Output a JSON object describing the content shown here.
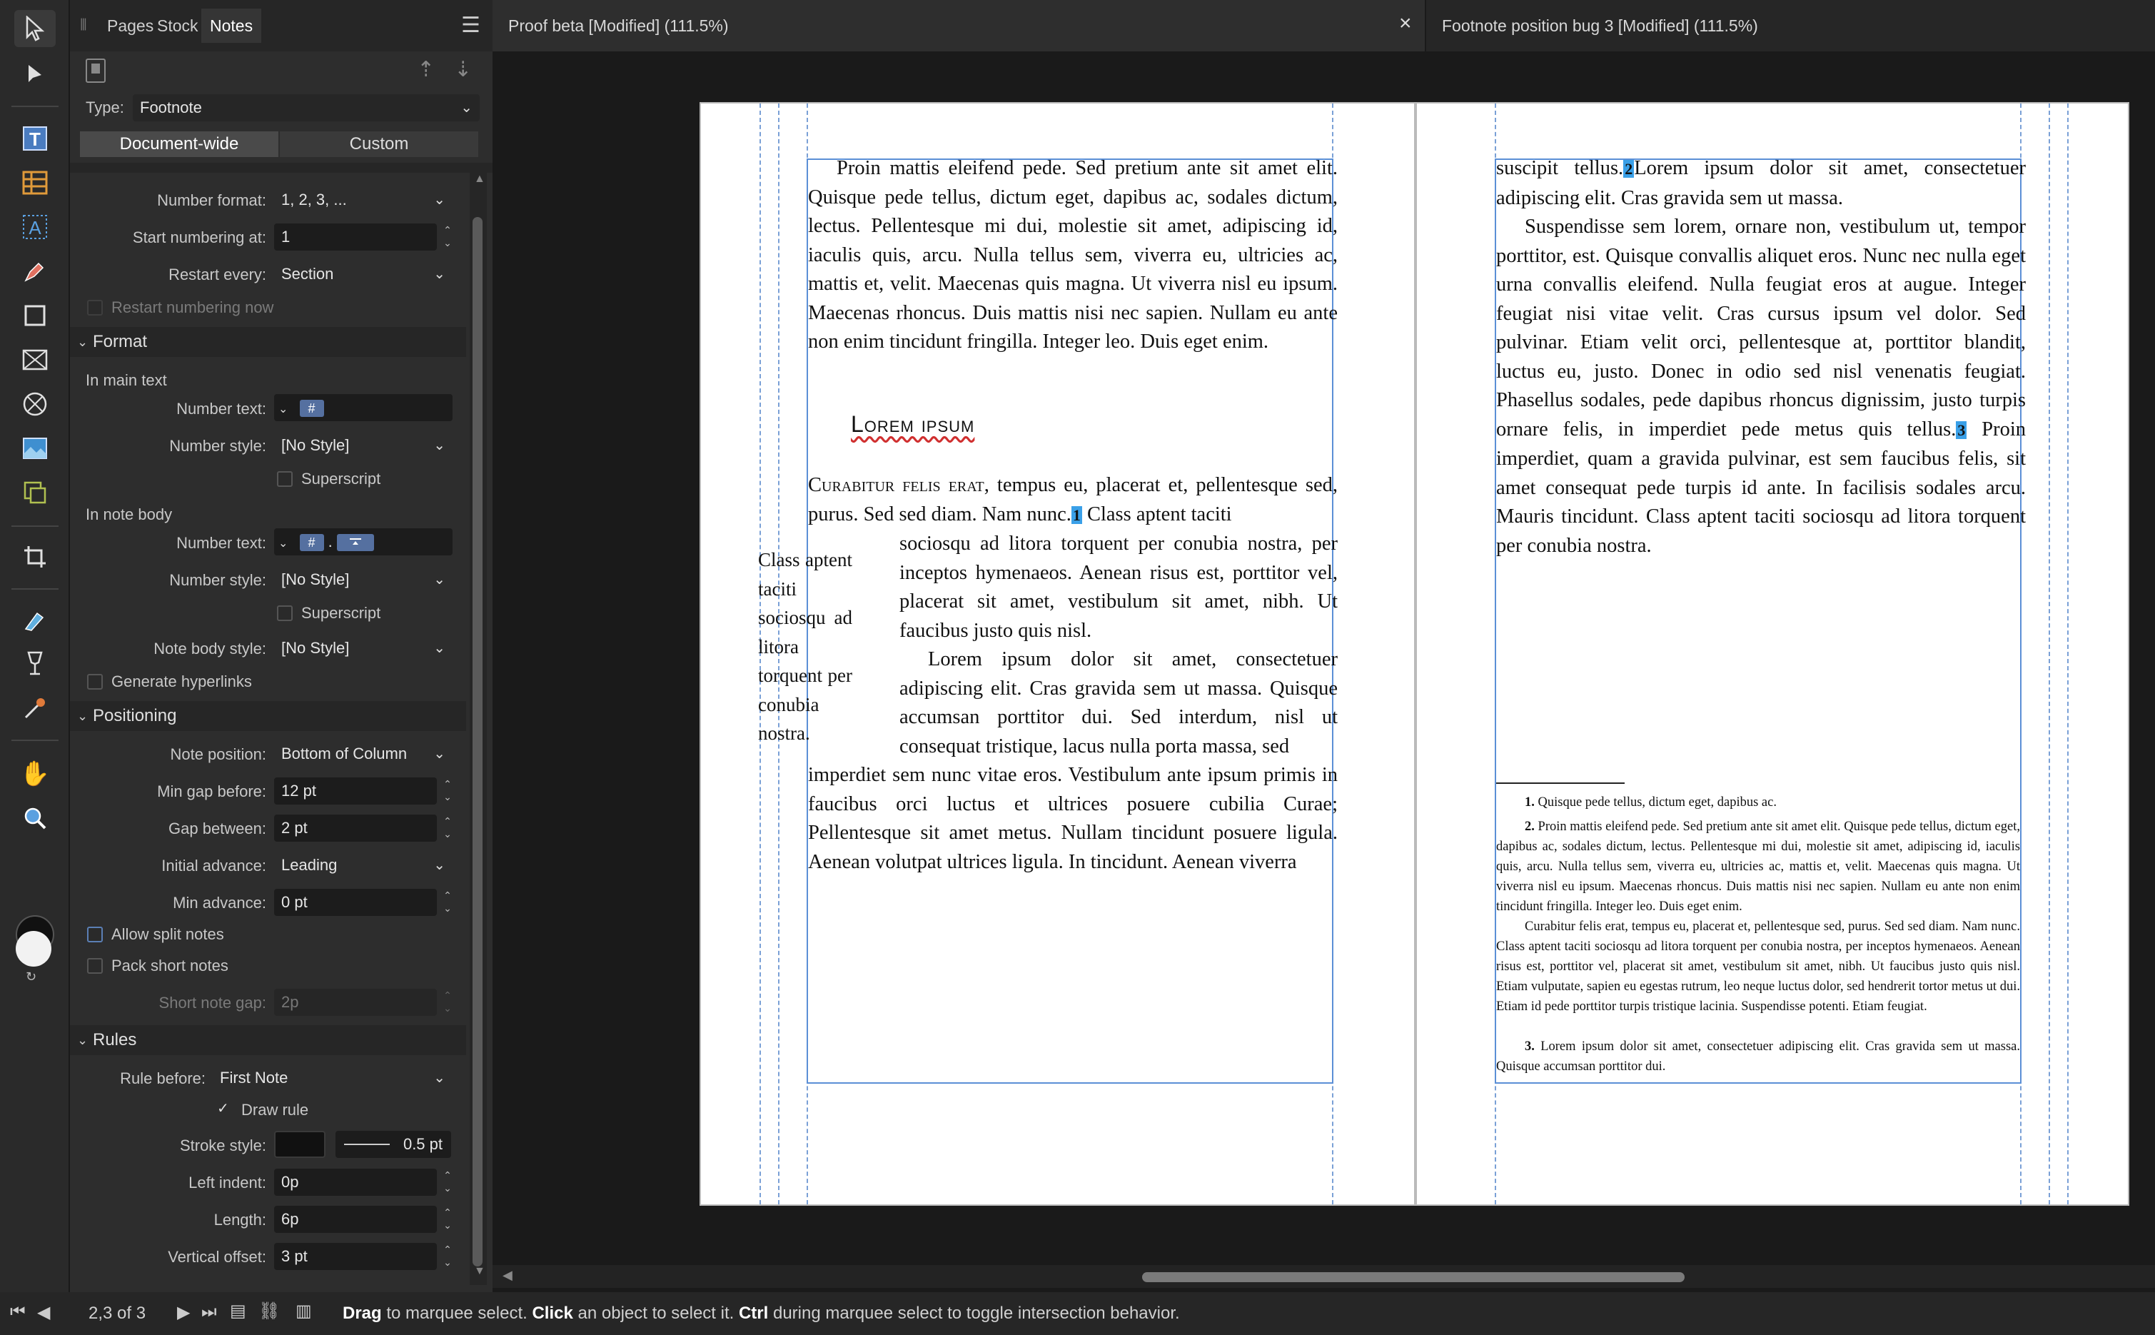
{
  "panel": {
    "tabs": [
      "Pages",
      "Stock",
      "Notes"
    ],
    "type_label": "Type:",
    "type_value": "Footnote",
    "scope_tabs": [
      "Document-wide",
      "Custom"
    ],
    "number_format_label": "Number format:",
    "number_format_value": "1, 2, 3, ...",
    "start_numbering_label": "Start numbering at:",
    "start_numbering_value": "1",
    "restart_every_label": "Restart every:",
    "restart_every_value": "Section",
    "restart_now_label": "Restart numbering now",
    "format_section": "Format",
    "in_main_text": "In main text",
    "number_text_label": "Number text:",
    "number_token": "#",
    "number_style_label": "Number style:",
    "number_style_value": "[No Style]",
    "superscript_label": "Superscript",
    "in_note_body": "In note body",
    "note_number_sep": ".",
    "note_body_style_label": "Note body style:",
    "note_body_style_value": "[No Style]",
    "generate_hyperlinks_label": "Generate hyperlinks",
    "positioning_section": "Positioning",
    "note_position_label": "Note position:",
    "note_position_value": "Bottom of Column",
    "min_gap_label": "Min gap before:",
    "min_gap_value": "12 pt",
    "gap_between_label": "Gap between:",
    "gap_between_value": "2 pt",
    "initial_advance_label": "Initial advance:",
    "initial_advance_value": "Leading",
    "min_advance_label": "Min advance:",
    "min_advance_value": "0 pt",
    "allow_split_label": "Allow split notes",
    "pack_short_label": "Pack short notes",
    "short_gap_label": "Short note gap:",
    "short_gap_value": "2p",
    "rules_section": "Rules",
    "rule_before_label": "Rule before:",
    "rule_before_value": "First Note",
    "draw_rule_label": "Draw rule",
    "stroke_style_label": "Stroke style:",
    "stroke_width_value": "0.5 pt",
    "left_indent_label": "Left indent:",
    "left_indent_value": "0p",
    "length_label": "Length:",
    "length_value": "6p",
    "vertical_offset_label": "Vertical offset:",
    "vertical_offset_value": "3 pt"
  },
  "documents": {
    "tab1": "Proof beta [Modified] (111.5%)",
    "tab2": "Footnote position bug 3 [Modified] (111.5%)",
    "close_glyph": "×"
  },
  "left_page": {
    "para1": "Proin mattis eleifend pede. Sed pretium ante sit amet elit. Quisque pede tellus, dictum eget, dapibus ac, sodales dictum, lectus. Pellentesque mi dui, molestie sit amet, adipiscing id, iaculis quis, arcu. Nulla tellus sem, viverra eu, ultricies ac, mattis et, velit. Maecenas quis magna. Ut viverra nisl eu ipsum. Maecenas rhoncus. Duis mattis nisi nec sapien. Nullam eu ante non enim tincidunt fringilla. Integer leo. Duis eget enim.",
    "heading": "Lorem ipsum",
    "para2_smallcaps": "Curabitur felis erat,",
    "para2_a": " tempus eu, placerat et, pellentesque sed, purus. Sed sed diam. Nam nunc.",
    "mark1": "1",
    "para2_b": " Class aptent taciti",
    "para2_wrap": "sociosqu ad litora torquent per conubia nostra, per inceptos hymenaeos. Aenean risus est, porttitor vel, placerat sit amet, vestibulum sit amet, nibh. Ut faucibus justo quis nisl.",
    "para3_wrap": "Lorem ipsum dolor sit amet, consectetuer adipiscing elit. Cras gravida sem ut massa. Quisque accumsan porttitor dui. Sed interdum, nisl ut consequat tristique, lacus nulla porta massa, sed",
    "para3_full": "imperdiet sem nunc vitae eros. Vestibulum ante ipsum primis in faucibus orci luctus et ultrices posuere cubilia Curae; Pellentesque sit amet metus. Nullam tincidunt posuere ligula. Aenean volutpat ultrices ligula. In tincidunt. Aenean viverra",
    "pullquote": "Class aptent taciti sociosqu ad litora torquent per conubia nostra."
  },
  "right_page": {
    "para1_a": "suscipit tellus.",
    "mark2": "2",
    "para1_b": "Lorem ipsum dolor sit amet, consectetuer adipiscing elit. Cras gravida sem ut massa.",
    "para2_a": "Suspendisse sem lorem, ornare non, vestibulum ut, tempor porttitor, est. Quisque convallis aliquet eros. Nunc nec nulla eget urna convallis eleifend. Nulla feugiat eros at augue. Integer feugiat nisi vitae velit. Cras cursus ipsum vel dolor. Sed pulvinar. Etiam velit orci, pellentesque at, porttitor blandit, luctus eu, justo. Donec in odio sed nisl venenatis feugiat. Phasellus sodales, pede dapibus rhoncus dignissim, justo turpis ornare felis, in imperdiet pede metus quis tellus.",
    "mark3": "3",
    "para2_b": " Proin imperdiet, quam a gravida pulvinar, est sem faucibus felis, sit amet consequat pede turpis id ante. In facilisis sodales arcu. Mauris tincidunt. Class aptent taciti sociosqu ad litora torquent per conubia nostra.",
    "fn1_num": "1.",
    "fn1": "Quisque pede tellus, dictum eget, dapibus ac.",
    "fn2_num": "2.",
    "fn2_a": "Proin mattis eleifend pede. Sed pretium ante sit amet elit. Quisque pede tellus, dictum eget, dapibus ac, sodales dictum, lectus. Pellentesque mi dui, molestie sit amet, adipiscing id, iaculis quis, arcu. Nulla tellus sem, viverra eu, ultricies ac, mattis et, velit. Maecenas quis magna. Ut viverra nisl eu ipsum. Maecenas rhoncus. Duis mattis nisi nec sapien. Nullam eu ante non enim tincidunt fringilla. Integer leo. Duis eget enim.",
    "fn2_b": "Curabitur felis erat, tempus eu, placerat et, pellentesque sed, purus. Sed sed diam. Nam nunc. Class aptent taciti sociosqu ad litora torquent per conubia nostra, per inceptos hymenaeos. Aenean risus est, porttitor vel, placerat sit amet, vestibulum sit amet, nibh. Ut faucibus justo quis nisl. Etiam vulputate, sapien eu egestas rutrum, leo neque luctus dolor, sed hendrerit tortor metus ut dui. Etiam id pede porttitor turpis tristique lacinia. Suspendisse potenti. Etiam feugiat.",
    "fn3_num": "3.",
    "fn3": "Lorem ipsum dolor sit amet, consectetuer adipiscing elit. Cras gravida sem ut massa. Quisque accumsan porttitor dui."
  },
  "status": {
    "page_indicator": "2,3 of 3",
    "hint_drag": "Drag",
    "hint_1": " to marquee select. ",
    "hint_click": "Click",
    "hint_2": " an object to select it. ",
    "hint_ctrl": "Ctrl",
    "hint_3": " during marquee select to toggle intersection behavior."
  }
}
